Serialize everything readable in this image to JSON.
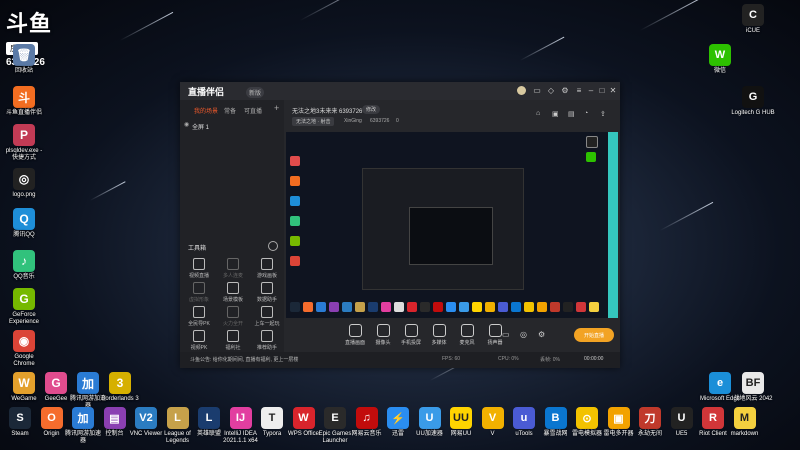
{
  "overlay": {
    "brand": "斗鱼",
    "room_tag": "房间号",
    "room_number": "6393726"
  },
  "desktop_left": [
    {
      "label": "回收站",
      "glyph": "🗑",
      "color": "#5b7aa6"
    },
    {
      "label": "斗鱼直播伴侣",
      "glyph": "斗",
      "color": "#f26d21"
    },
    {
      "label": "plsqldev.exe - 快捷方式",
      "glyph": "P",
      "color": "#c23b55"
    },
    {
      "label": "logo.png",
      "glyph": "◎",
      "color": "#222"
    },
    {
      "label": "腾讯QQ",
      "glyph": "Q",
      "color": "#1e8ed8"
    },
    {
      "label": "QQ音乐",
      "glyph": "♪",
      "color": "#31c27c"
    },
    {
      "label": "GeForce Experience",
      "glyph": "G",
      "color": "#76b900"
    },
    {
      "label": "Google Chrome",
      "glyph": "◉",
      "color": "#db4437"
    },
    {
      "label": "WeGame",
      "glyph": "W",
      "color": "#e3a02c"
    },
    {
      "label": "GeeGee",
      "glyph": "G",
      "color": "#e04c8e"
    },
    {
      "label": "腾讯网游加速器",
      "glyph": "加",
      "color": "#2a7bd4"
    },
    {
      "label": "Borderlands 3",
      "glyph": "3",
      "color": "#d6b000"
    }
  ],
  "taskbar": [
    {
      "label": "Steam",
      "glyph": "S",
      "color": "#1b2838"
    },
    {
      "label": "Origin",
      "glyph": "O",
      "color": "#f56c2d"
    },
    {
      "label": "腾讯网游加速器",
      "glyph": "加",
      "color": "#2a7bd4"
    },
    {
      "label": "控制台",
      "glyph": "▤",
      "color": "#8a3fb2"
    },
    {
      "label": "VNC Viewer",
      "glyph": "V2",
      "color": "#2b7cc1"
    },
    {
      "label": "League of Legends",
      "glyph": "L",
      "color": "#c6a14a"
    },
    {
      "label": "英雄联盟",
      "glyph": "L",
      "color": "#1a3c6e"
    },
    {
      "label": "IntelliJ IDEA 2021.1.1 x64",
      "glyph": "IJ",
      "color": "#e23ea0"
    },
    {
      "label": "Typora",
      "glyph": "T",
      "color": "#eeeeee"
    },
    {
      "label": "WPS Office",
      "glyph": "W",
      "color": "#d9242c"
    },
    {
      "label": "Epic Games Launcher",
      "glyph": "E",
      "color": "#2a2a2a"
    },
    {
      "label": "网易云音乐",
      "glyph": "♫",
      "color": "#c20c0c"
    },
    {
      "label": "迅雷",
      "glyph": "⚡",
      "color": "#2a8df0"
    },
    {
      "label": "UU加速器",
      "glyph": "U",
      "color": "#3a9be8"
    },
    {
      "label": "网易UU",
      "glyph": "UU",
      "color": "#ffd400"
    },
    {
      "label": "V",
      "glyph": "V",
      "color": "#f2b100"
    },
    {
      "label": "uTools",
      "glyph": "u",
      "color": "#4a5bd4"
    },
    {
      "label": "暴雪战网",
      "glyph": "B",
      "color": "#0a76d0"
    },
    {
      "label": "雷电模拟器",
      "glyph": "⊙",
      "color": "#f2c200"
    },
    {
      "label": "雷电多开器",
      "glyph": "▣",
      "color": "#f2a200"
    },
    {
      "label": "永劫无间",
      "glyph": "刀",
      "color": "#c0392b"
    },
    {
      "label": "UE5",
      "glyph": "U",
      "color": "#222"
    },
    {
      "label": "Riot Client",
      "glyph": "R",
      "color": "#d13639"
    },
    {
      "label": "markdown",
      "glyph": "M",
      "color": "#f4d03f"
    }
  ],
  "desktop_right": [
    {
      "label": "iCUE",
      "glyph": "C",
      "color": "#222"
    },
    {
      "label": "微信",
      "glyph": "W",
      "color": "#2dc100"
    },
    {
      "label": "Logitech G HUB",
      "glyph": "G",
      "color": "#111"
    },
    {
      "label": "Microsoft Edge",
      "glyph": "e",
      "color": "#1b8fd8"
    },
    {
      "label": "战地风云 2042",
      "glyph": "BF",
      "color": "#e9e9e9"
    }
  ],
  "companion": {
    "app_name": "直播伴侣",
    "version": "新版",
    "sidebar_tabs": [
      "我的场景",
      "常备",
      "可直播",
      "+"
    ],
    "scene_name": "全屏 1",
    "tools_title": "工具箱",
    "tools": [
      {
        "label": "视频直播",
        "dim": false
      },
      {
        "label": "多人连麦",
        "dim": true
      },
      {
        "label": "游戏画板",
        "dim": false
      },
      {
        "label": "虚拟形象",
        "dim": true
      },
      {
        "label": "场景模板",
        "dim": false
      },
      {
        "label": "数据助手",
        "dim": false
      },
      {
        "label": "全民导PK",
        "dim": false
      },
      {
        "label": "火力全开",
        "dim": true
      },
      {
        "label": "上车一起玩",
        "dim": false
      },
      {
        "label": "视频PK",
        "dim": false
      },
      {
        "label": "福利社",
        "dim": false
      },
      {
        "label": "推荐助手",
        "dim": false
      }
    ],
    "room_title": "无法之地3未来来 6393726",
    "room_button": "修改",
    "category": "无法之地 · 射击",
    "anchor": "XinGing",
    "room_id": "6393726",
    "hot_value": "0",
    "controls": [
      "直播画面",
      "摄像头",
      "手机投屏",
      "多媒体",
      "麦克风",
      "扬声器"
    ],
    "start_button": "开始直播",
    "notice": "斗鱼公告: 给你化期间间, 直播有福利, 更上一层楼",
    "stats": [
      "FPS: 60",
      "CPU: 0%",
      "丢帧: 0%"
    ],
    "timer": "00:00:00"
  },
  "colors": {
    "accent": "#f25a2b",
    "teal": "#35c7be",
    "start": "#f2a324"
  }
}
